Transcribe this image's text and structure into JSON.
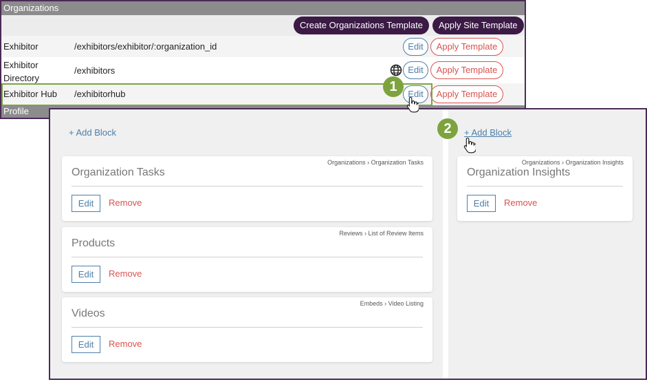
{
  "organizations": {
    "header": "Organizations",
    "create_template_label": "Create Organizations Template",
    "apply_site_template_label": "Apply Site Template",
    "rows": [
      {
        "name": "Exhibitor",
        "path": "/exhibitors/exhibitor/:organization_id",
        "edit_label": "Edit",
        "apply_label": "Apply Template",
        "globe": false
      },
      {
        "name": "Exhibitor Directory",
        "path": "/exhibitors",
        "edit_label": "Edit",
        "apply_label": "Apply Template",
        "globe": true
      },
      {
        "name": "Exhibitor Hub",
        "path": "/exhibitorhub",
        "edit_label": "Edit",
        "apply_label": "Apply Template",
        "globe": false
      }
    ],
    "profile_label": "Profile"
  },
  "steps": {
    "one": "1",
    "two": "2"
  },
  "builder": {
    "left_add_block": "+ Add Block",
    "right_add_block": "+ Add Block",
    "left_cards": [
      {
        "title": "Organization Tasks",
        "crumb": "Organizations › Organization Tasks",
        "edit_label": "Edit",
        "remove_label": "Remove"
      },
      {
        "title": "Products",
        "crumb": "Reviews › List of Review Items",
        "edit_label": "Edit",
        "remove_label": "Remove"
      },
      {
        "title": "Videos",
        "crumb": "Embeds › Video Listing",
        "edit_label": "Edit",
        "remove_label": "Remove"
      }
    ],
    "right_cards": [
      {
        "title": "Organization Insights",
        "crumb": "Organizations › Organization Insights",
        "edit_label": "Edit",
        "remove_label": "Remove"
      }
    ]
  },
  "colors": {
    "accent_dark": "#3b1a45",
    "step_green": "#7da33f",
    "link_blue": "#4c7ea8",
    "danger_red": "#d9534f"
  },
  "icons": [
    "globe-icon",
    "hand-pointer-icon"
  ]
}
